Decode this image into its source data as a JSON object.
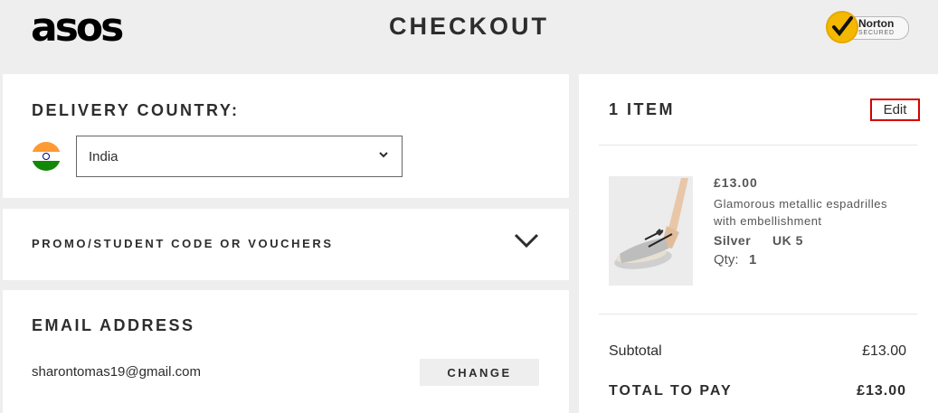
{
  "header": {
    "logo": "asos",
    "title": "CHECKOUT",
    "norton": {
      "brand": "Norton",
      "sub": "SECURED"
    }
  },
  "delivery": {
    "heading": "DELIVERY COUNTRY:",
    "country": "India"
  },
  "promo": {
    "label": "PROMO/STUDENT CODE OR VOUCHERS"
  },
  "email": {
    "heading": "EMAIL ADDRESS",
    "value": "sharontomas19@gmail.com",
    "change_label": "CHANGE"
  },
  "bag": {
    "heading": "1 ITEM",
    "edit_label": "Edit",
    "item": {
      "price": "£13.00",
      "name": "Glamorous metallic espadrilles with embellishment",
      "color": "Silver",
      "size": "UK 5",
      "qty_label": "Qty:",
      "qty": "1"
    },
    "subtotal_label": "Subtotal",
    "subtotal": "£13.00",
    "total_label": "TOTAL TO PAY",
    "total": "£13.00"
  },
  "icons": {
    "dropdown": "chevron-down-icon",
    "promo_toggle": "chevron-down-icon",
    "norton_check": "checkmark-icon"
  },
  "colors": {
    "accent_border": "#d40000",
    "background": "#eeeeee",
    "panel": "#ffffff"
  }
}
